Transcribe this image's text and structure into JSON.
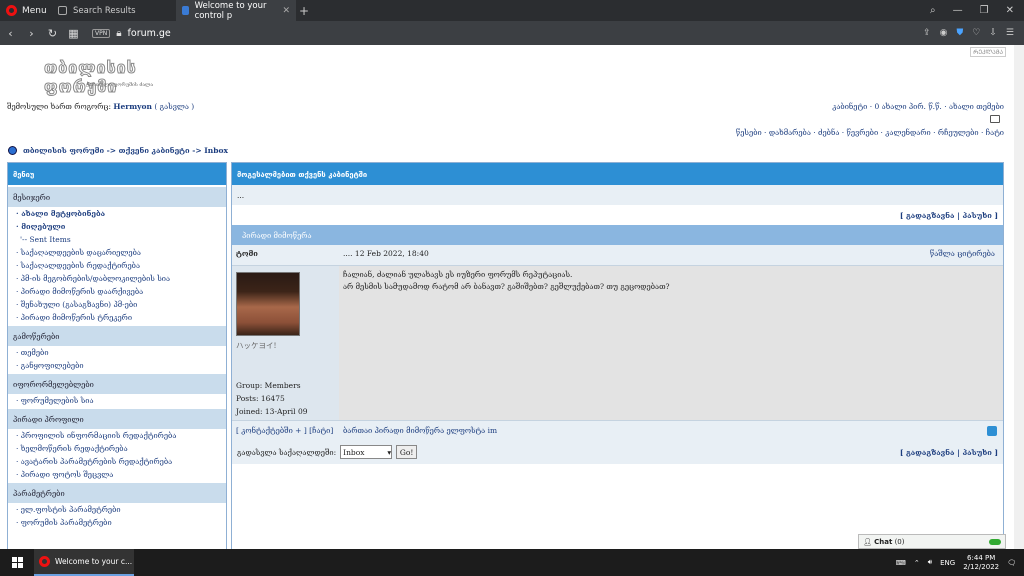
{
  "browser": {
    "menu_label": "Menu",
    "tabs": [
      {
        "title": "Search Results"
      },
      {
        "title": "Welcome to your control p"
      }
    ],
    "new_tab": "+",
    "vpn_label": "VPN",
    "url": "forum.ge",
    "colors": {
      "tabbar": "#2b2d30",
      "addressbar": "#3c3f43",
      "opera_red": "#e11"
    }
  },
  "header": {
    "logo_text": "თბილისის ფორუმი",
    "logo_subtext": "ქართული ფორუმის ძალა",
    "corner_ad": "ᲠᲔᲙᲚᲐᲛᲐ",
    "logged_in_prefix": "შემოსული ხართ როგორც:",
    "username": "Hermyon",
    "logout": "( გასვლა )",
    "top_right": "კაბინეტი · 0 ახალი პირ. წ.წ. · ახალი თემები",
    "nav_links": "წესები · დახმარება · ძებნა · წევრები · კალენდარი · რჩეულები · ჩატი"
  },
  "breadcrumb": "თბილისის ფორუმი -> თქვენი კაბინეტი -> Inbox",
  "sidebar": {
    "title": "მენიუ",
    "sections": [
      {
        "title": "მესიჯერი",
        "items": [
          {
            "label": "· ახალი მეტყობინება",
            "bold": true
          },
          {
            "label": "· მიღებული",
            "bold": true
          },
          {
            "label": "'-- Sent Items",
            "sub": true
          },
          {
            "label": "· საქაღალდეების დაცარიელება"
          },
          {
            "label": "· საქაღალდეების რედაქტირება"
          },
          {
            "label": "· პმ-ის მეგობრების/დაბლოკილების სია"
          },
          {
            "label": "· პირადი მიმოწერის დაარქივება"
          },
          {
            "label": "· შენახული (გასაგზავნი) პმ-ები"
          },
          {
            "label": "· პირადი მიმოწერის ტრეკერი"
          }
        ]
      },
      {
        "title": "გამოწერები",
        "items": [
          {
            "label": "· თემები"
          },
          {
            "label": "· განყოფილებები"
          }
        ]
      },
      {
        "title": "იფორორმელებლები",
        "items": [
          {
            "label": "· ფორუმელების სია"
          }
        ]
      },
      {
        "title": "პირადი პროფილი",
        "items": [
          {
            "label": "· პროფილის ინფორმაციის რედაქტირება"
          },
          {
            "label": "· ხელმოწერის რედაქტირება"
          },
          {
            "label": "· ავატარის პარამეტრების რედაქტირება"
          },
          {
            "label": "· პირადი ფოტოს შეცვლა"
          }
        ]
      },
      {
        "title": "პარამეტრები",
        "items": [
          {
            "label": "· ელ.ფოსტის პარამეტრები"
          },
          {
            "label": "· ფორუმის პარამეტრები"
          }
        ]
      }
    ]
  },
  "main": {
    "title": "მოგესალმებით თქვენს კაბინეტში",
    "ellipsis": "...",
    "forward_reply": "[ გადაგზავნა | პასუხი ]",
    "band_title": "პირადი მიმოწერა",
    "post": {
      "author": "ტომი",
      "date": ".... 12 Feb 2022, 18:40",
      "quote": "წაშლა ციტირება",
      "avatar_caption": "ハッケヨイ!",
      "group": "Group: Members",
      "posts": "Posts: 16475",
      "joined": "Joined: 13-April 09",
      "line1": "ჩალიან, ძალიან ულახავს ეს იუზერი ფორუმს რეპუტაციას.",
      "line2": "არ მესმის სამუდამოდ რატომ არ ბანავთ? გაშიშებთ? გეშლუქებათ? თუ გეცოდებათ?"
    },
    "footer_left": "[ კონტაქტებში + ] [ჩატი]",
    "footer_right": "ბართაი პირადი მიმოწერა ელფოსტა im",
    "move_label": "გადასვლა საქაღალდეში:",
    "select_value": "Inbox",
    "go_label": "Go!"
  },
  "chat": {
    "label": "Chat",
    "count": "(0)"
  },
  "taskbar": {
    "app_title": "Welcome to your c...",
    "time": "6:44 PM",
    "date": "2/12/2022",
    "lang": "ENG"
  }
}
